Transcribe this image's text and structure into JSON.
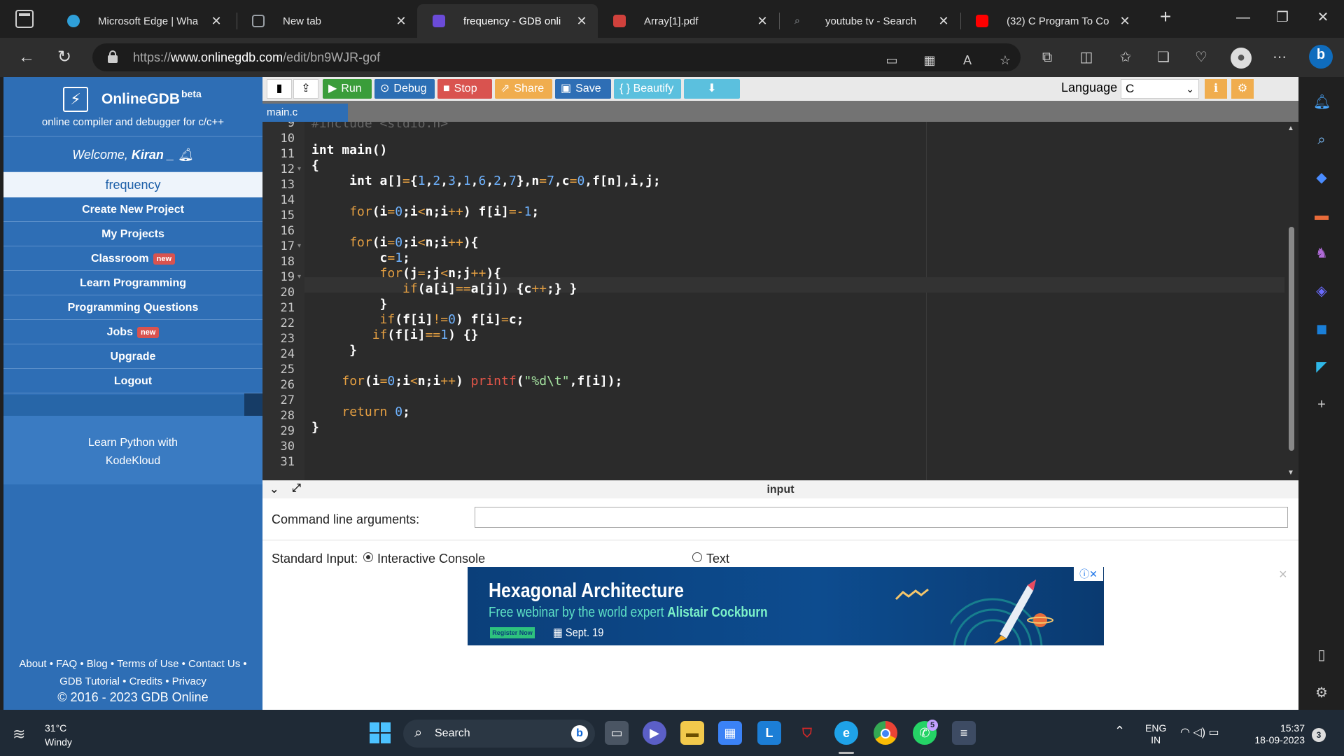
{
  "browser": {
    "tabs": [
      {
        "title": "Microsoft Edge | Wha",
        "favicon_color": "#2f9fd8"
      },
      {
        "title": "New tab",
        "favicon_color": "#9aa0a6"
      },
      {
        "title": "frequency - GDB onli",
        "favicon_color": "#6b4bd8"
      },
      {
        "title": "Array[1].pdf",
        "favicon_color": "#d0413c"
      },
      {
        "title": "youtube tv - Search",
        "favicon_color": "#3a3a3a"
      },
      {
        "title": "(32) C Program To Co",
        "favicon_color": "#ff0000"
      }
    ],
    "close_glyph": "✕",
    "new_tab_glyph": "+",
    "window": {
      "minimize": "—",
      "restore": "❐",
      "close": "✕"
    },
    "url_prefix": "https://",
    "url_host": "www.onlinegdb.com",
    "url_path": "/edit/bn9WJR-gof"
  },
  "gdb": {
    "logo_glyph": "⚡",
    "brand": "OnlineGDB",
    "beta": "beta",
    "tagline": "online compiler and debugger for c/c++",
    "welcome_prefix": "Welcome, ",
    "user": "Kiran",
    "welcome_suffix": " _ ",
    "current_project": "frequency",
    "menu": [
      {
        "label": "Create New Project",
        "badge": ""
      },
      {
        "label": "My Projects",
        "badge": ""
      },
      {
        "label": "Classroom",
        "badge": "new"
      },
      {
        "label": "Learn Programming",
        "badge": ""
      },
      {
        "label": "Programming Questions",
        "badge": ""
      },
      {
        "label": "Jobs",
        "badge": "new"
      },
      {
        "label": "Upgrade",
        "badge": ""
      },
      {
        "label": "Logout",
        "badge": ""
      }
    ],
    "promo_line1": "Learn Python with",
    "promo_line2": "KodeKloud",
    "footer_line1": "About • FAQ • Blog • Terms of Use • Contact Us •",
    "footer_line2": "GDB Tutorial • Credits • Privacy",
    "copyright": "© 2016 - 2023 GDB Online",
    "toolbar": {
      "run": "Run",
      "debug": "Debug",
      "stop": "Stop",
      "share": "Share",
      "save": "Save",
      "beautify": "{ } Beautify",
      "language_label": "Language",
      "language_value": "C",
      "colors": {
        "run": "#3a9d3a",
        "debug": "#2c6fb5",
        "stop": "#d9534f",
        "share": "#f0ad4e",
        "save": "#2e6eb5",
        "beautify": "#5bc0de",
        "download": "#5bc0de"
      }
    },
    "file_tab": "main.c",
    "code_lines": [
      {
        "n": "9",
        "fold": ""
      },
      {
        "n": "10",
        "fold": ""
      },
      {
        "n": "11",
        "fold": ""
      },
      {
        "n": "12",
        "fold": "▾"
      },
      {
        "n": "13",
        "fold": ""
      },
      {
        "n": "14",
        "fold": ""
      },
      {
        "n": "15",
        "fold": ""
      },
      {
        "n": "16",
        "fold": ""
      },
      {
        "n": "17",
        "fold": "▾"
      },
      {
        "n": "18",
        "fold": ""
      },
      {
        "n": "19",
        "fold": "▾"
      },
      {
        "n": "20",
        "fold": ""
      },
      {
        "n": "21",
        "fold": ""
      },
      {
        "n": "22",
        "fold": ""
      },
      {
        "n": "23",
        "fold": ""
      },
      {
        "n": "24",
        "fold": ""
      },
      {
        "n": "25",
        "fold": ""
      },
      {
        "n": "26",
        "fold": ""
      },
      {
        "n": "27",
        "fold": ""
      },
      {
        "n": "28",
        "fold": ""
      },
      {
        "n": "29",
        "fold": ""
      },
      {
        "n": "30",
        "fold": ""
      },
      {
        "n": "31",
        "fold": ""
      }
    ],
    "io": {
      "title": "input",
      "cmd_label": "Command line arguments:",
      "cmd_value": "",
      "stdin_label": "Standard Input:",
      "opt_interactive": "Interactive Console",
      "opt_text": "Text",
      "selected": "Interactive Console"
    },
    "ad": {
      "title": "Hexagonal Architecture",
      "sub_prefix": "Free webinar by the world expert ",
      "sub_name": "Alistair Cockburn",
      "register": "Register Now",
      "date": "Sept. 19",
      "badge": "ⓘ✕",
      "close": "×"
    }
  },
  "taskbar": {
    "temp": "31°C",
    "weather": "Windy",
    "search": "Search",
    "lang_line1": "ENG",
    "lang_line2": "IN",
    "time": "15:37",
    "date": "18-09-2023",
    "notifications": "3",
    "whatsapp_badge": "5"
  }
}
